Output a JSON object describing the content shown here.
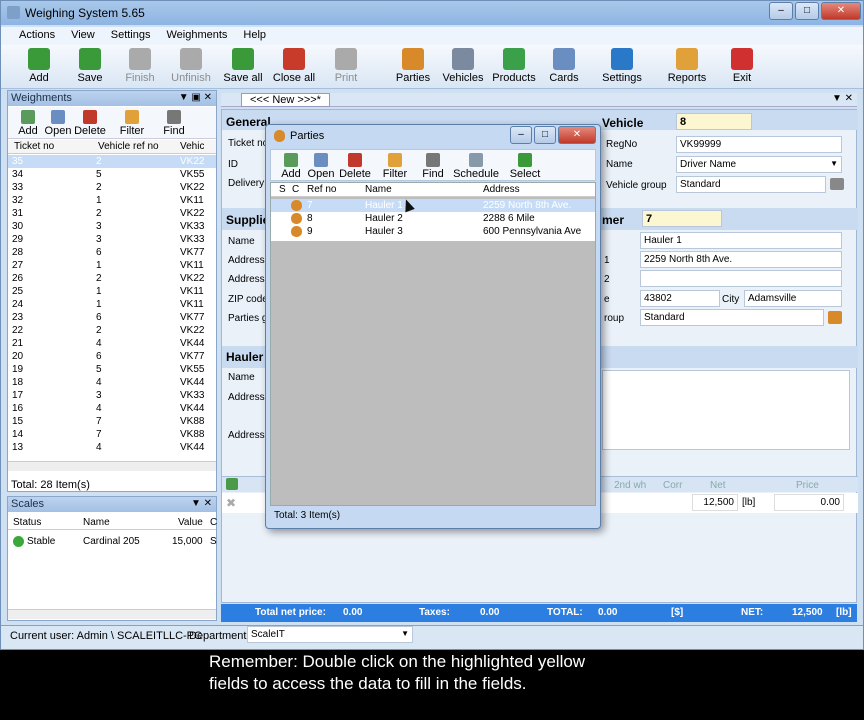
{
  "app": {
    "title": "Weighing System 5.65"
  },
  "menu": [
    "Actions",
    "View",
    "Settings",
    "Weighments",
    "Help"
  ],
  "toolbar": [
    {
      "label": "Add",
      "icon": "add-icon",
      "color": "#3a9a3a"
    },
    {
      "label": "Save",
      "icon": "save-icon",
      "color": "#3a9a3a"
    },
    {
      "label": "Finish",
      "icon": "finish-icon",
      "color": "#aaaaaa"
    },
    {
      "label": "Unfinish",
      "icon": "unfinish-icon",
      "color": "#aaaaaa"
    },
    {
      "label": "Save all",
      "icon": "save-all-icon",
      "color": "#3a9a3a"
    },
    {
      "label": "Close all",
      "icon": "close-all-icon",
      "color": "#c83a2a"
    },
    {
      "label": "Print",
      "icon": "printer-icon",
      "color": "#aaaaaa"
    },
    {
      "label": "Parties",
      "icon": "parties-icon",
      "color": "#d8892a"
    },
    {
      "label": "Vehicles",
      "icon": "truck-icon",
      "color": "#7c8aa0"
    },
    {
      "label": "Products",
      "icon": "products-icon",
      "color": "#3aa04a"
    },
    {
      "label": "Cards",
      "icon": "cards-icon",
      "color": "#6a8ec2"
    },
    {
      "label": "Settings",
      "icon": "gear-icon",
      "color": "#2a78c8"
    },
    {
      "label": "Reports",
      "icon": "reports-icon",
      "color": "#e0a03a"
    },
    {
      "label": "Exit",
      "icon": "exit-icon",
      "color": "#d03030"
    }
  ],
  "weighments": {
    "title": "Weighments",
    "buttons": [
      "Add",
      "Open",
      "Delete",
      "Filter",
      "Find"
    ],
    "columns": [
      "Ticket no",
      "Vehicle ref no",
      "Vehic"
    ],
    "rows": [
      [
        "35",
        "2",
        "VK22"
      ],
      [
        "34",
        "5",
        "VK55"
      ],
      [
        "33",
        "2",
        "VK22"
      ],
      [
        "32",
        "1",
        "VK11"
      ],
      [
        "31",
        "2",
        "VK22"
      ],
      [
        "30",
        "3",
        "VK33"
      ],
      [
        "29",
        "3",
        "VK33"
      ],
      [
        "28",
        "6",
        "VK77"
      ],
      [
        "27",
        "1",
        "VK11"
      ],
      [
        "26",
        "2",
        "VK22"
      ],
      [
        "25",
        "1",
        "VK11"
      ],
      [
        "24",
        "1",
        "VK11"
      ],
      [
        "23",
        "6",
        "VK77"
      ],
      [
        "22",
        "2",
        "VK22"
      ],
      [
        "21",
        "4",
        "VK44"
      ],
      [
        "20",
        "6",
        "VK77"
      ],
      [
        "19",
        "5",
        "VK55"
      ],
      [
        "18",
        "4",
        "VK44"
      ],
      [
        "17",
        "3",
        "VK33"
      ],
      [
        "16",
        "4",
        "VK44"
      ],
      [
        "15",
        "7",
        "VK88"
      ],
      [
        "14",
        "7",
        "VK88"
      ],
      [
        "13",
        "4",
        "VK44"
      ]
    ],
    "total": "Total: 28 Item(s)"
  },
  "scales": {
    "title": "Scales",
    "columns": [
      "Status",
      "Name",
      "Value",
      "C"
    ],
    "row": {
      "status": "Stable",
      "name": "Cardinal 205",
      "value": "15,000",
      "c": "S"
    }
  },
  "tab": {
    "label": "<<< New >>>*"
  },
  "general": {
    "title": "General",
    "labels": [
      "Ticket no",
      "ID",
      "Delivery d"
    ]
  },
  "supplier": {
    "title": "Supplie",
    "labels": [
      "Name",
      "Address",
      "Address 2",
      "ZIP code",
      "Parties gr"
    ]
  },
  "hauler": {
    "title": "Hauler",
    "labels": [
      "Name",
      "Address",
      "Address 2"
    ]
  },
  "vehicle": {
    "title": "Vehicle",
    "value": "8",
    "labels": [
      "RegNo",
      "Name",
      "Vehicle group"
    ],
    "regno": "VK99999",
    "name": "Driver Name",
    "group": "Standard"
  },
  "customer": {
    "title": "mer",
    "value": "7",
    "labels": [
      "1",
      "2",
      "e",
      "City",
      "roup"
    ],
    "name": "Hauler 1",
    "address": "2259 North 8th Ave.",
    "zip": "43802",
    "city": "Adamsville",
    "group": "Standard"
  },
  "weighgrid": {
    "columns": [
      "2nd wh",
      "Corr",
      "Net",
      "Price"
    ],
    "net": "12,500",
    "unit": "[lb]",
    "price": "0.00"
  },
  "totals": {
    "net_price_label": "Total net price:",
    "net_price": "0.00",
    "taxes_label": "Taxes:",
    "taxes": "0.00",
    "total_label": "TOTAL:",
    "total": "0.00",
    "currency": "[$]",
    "net_label": "NET:",
    "net": "12,500",
    "net_unit": "[lb]"
  },
  "status": {
    "user": "Current user: Admin \\ SCALEITLLC-PC",
    "dept_label": "Department",
    "dept": "ScaleIT"
  },
  "dialog": {
    "title": "Parties",
    "buttons": [
      "Add",
      "Open",
      "Delete",
      "Filter",
      "Find",
      "Schedule",
      "Select"
    ],
    "columns": [
      "S",
      "C",
      "Ref no",
      "Name",
      "Address"
    ],
    "rows": [
      [
        "7",
        "Hauler 1",
        "2259 North 8th Ave."
      ],
      [
        "8",
        "Hauler 2",
        "2288 6 Mile"
      ],
      [
        "9",
        "Hauler 3",
        "600 Pennsylvania Ave"
      ]
    ],
    "total": "Total: 3 Item(s)"
  },
  "caption": {
    "line1": "Remember: Double click on the highlighted yellow",
    "line2": "fields to access the data to fill in the fields."
  },
  "colors": {
    "accent": "#1f6fd6",
    "selected": "#c6dcf6",
    "caption_bg": "#000000"
  }
}
